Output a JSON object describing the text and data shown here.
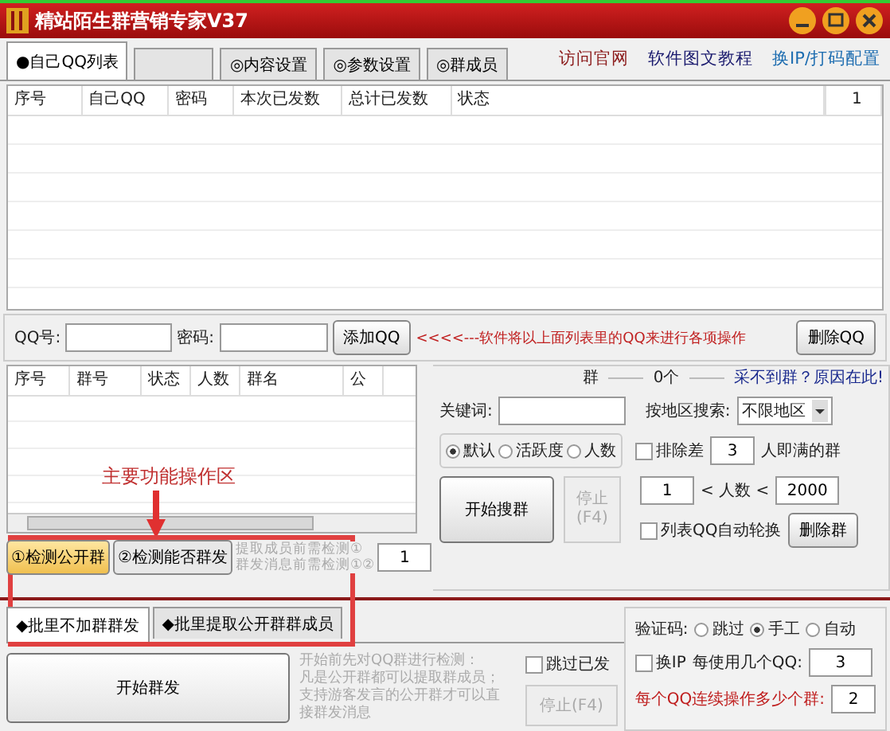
{
  "window": {
    "title": "精站陌生群营销专家V37"
  },
  "tabs": [
    {
      "label": "●自己QQ列表",
      "selected": true
    },
    {
      "selected": false
    },
    {
      "label": "◎内容设置",
      "selected": false
    },
    {
      "label": "◎参数设置",
      "selected": false
    },
    {
      "label": "◎群成员",
      "selected": false
    }
  ],
  "links": [
    {
      "label": "访问官网",
      "color": "#8b1a1a"
    },
    {
      "label": "软件图文教程",
      "color": "#1a1a6e"
    },
    {
      "label": "换IP/打码配置",
      "color": "#1c6cb0"
    }
  ],
  "qq_table": {
    "columns": [
      "序号",
      "自己QQ",
      "密码",
      "本次已发数",
      "总计已发数",
      "状态"
    ],
    "counter": "1"
  },
  "add_row": {
    "qq_label": "QQ号:",
    "password_label": "密码:",
    "add_button": "添加QQ",
    "hint": "<<<<---软件将以上面列表里的QQ来进行各项操作",
    "delete_button": "删除QQ"
  },
  "group_table": {
    "columns": [
      "序号",
      "群号",
      "状态",
      "人数",
      "群名",
      "公"
    ]
  },
  "annotation": "主要功能操作区",
  "check_buttons": [
    {
      "label": "①检测公开群",
      "selected": true
    },
    {
      "label": "②检测能否群发",
      "selected": false
    }
  ],
  "check_hint": [
    "提取成员前需检测①",
    "群发消息前需检测①②"
  ],
  "check_value": "1",
  "search": {
    "header_end": "群",
    "count": "0个",
    "help_link": "采不到群？原因在此!",
    "keyword_label": "关键词:",
    "region_label": "按地区搜索:",
    "region_value": "不限地区",
    "sort": [
      {
        "label": "默认",
        "selected": true
      },
      {
        "label": "活跃度",
        "selected": false
      },
      {
        "label": "人数",
        "selected": false
      }
    ],
    "exclude": {
      "label_before": "排除差",
      "value": "3",
      "label_after": "人即满的群",
      "checked": false
    },
    "start_button": "开始搜群",
    "stop_button": "停止(F4)",
    "stop_disabled": true,
    "min_members": "1",
    "range_label": "< 人数 <",
    "max_members": "2000",
    "rotate": {
      "label": "列表QQ自动轮换",
      "checked": false
    },
    "delete_button": "删除群"
  },
  "bottom_tabs": [
    {
      "label": "◆批里不加群群发",
      "selected": true
    },
    {
      "label": "◆批里提取公开群群成员",
      "selected": false
    }
  ],
  "send": {
    "start_button": "开始群发",
    "description": [
      "开始前先对QQ群进行检测：",
      "凡是公开群都可以提取群成员；",
      "支持游客发言的公开群才可以直",
      "接群发消息"
    ],
    "skip_sent": {
      "label": "跳过已发",
      "checked": false
    },
    "stop_button": "停止(F4)",
    "stop_disabled": true
  },
  "captcha": {
    "label": "验证码:",
    "options": [
      {
        "label": "跳过",
        "selected": false
      },
      {
        "label": "手工",
        "selected": true
      },
      {
        "label": "自动",
        "selected": false
      }
    ],
    "change_ip": {
      "label": "换IP",
      "checked": false
    },
    "per_qq_label": "每使用几个QQ:",
    "per_qq_value": "3",
    "groups_label": "每个QQ连续操作多少个群:",
    "groups_value": "2"
  }
}
